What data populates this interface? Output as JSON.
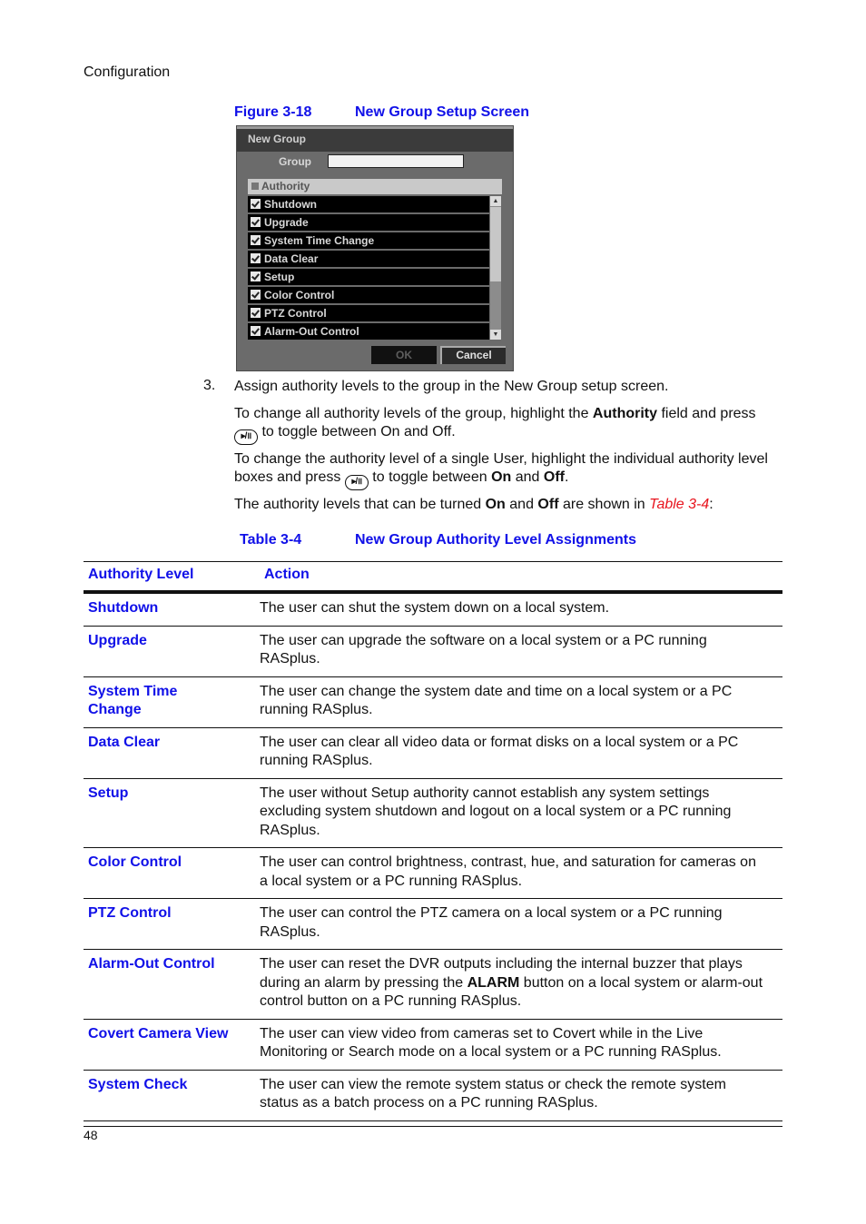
{
  "header": {
    "section": "Configuration"
  },
  "figure": {
    "number": "Figure 3-18",
    "title": "New Group Setup Screen",
    "screen": {
      "title": "New Group",
      "group_label": "Group",
      "group_value": "",
      "authority_header": "Authority",
      "items": [
        {
          "label": "Shutdown",
          "checked": true
        },
        {
          "label": "Upgrade",
          "checked": true
        },
        {
          "label": "System Time Change",
          "checked": true
        },
        {
          "label": "Data Clear",
          "checked": true
        },
        {
          "label": "Setup",
          "checked": true
        },
        {
          "label": "Color Control",
          "checked": true
        },
        {
          "label": "PTZ Control",
          "checked": true
        },
        {
          "label": "Alarm-Out Control",
          "checked": true
        }
      ],
      "scroll_up_icon": "▲",
      "scroll_down_icon": "▼",
      "ok_label": "OK",
      "cancel_label": "Cancel"
    }
  },
  "step": {
    "number": "3.",
    "text": "Assign authority levels to the group in the New Group setup screen.",
    "p2_a": "To change all authority levels of the group, highlight the ",
    "p2_bold": "Authority",
    "p2_b": " field and press ",
    "p2_c": " to toggle between On and Off.",
    "p3_a": "To change the authority level of a single User, highlight the individual authority level boxes and press ",
    "p3_b": " to toggle between ",
    "p3_on": "On",
    "p3_and": " and ",
    "p3_off": "Off",
    "p3_end": ".",
    "p4_a": "The authority levels that can be turned ",
    "p4_on": "On",
    "p4_and": " and ",
    "p4_off": "Off",
    "p4_b": " are shown in ",
    "p4_ref": "Table 3-4",
    "p4_end": ":",
    "toggle_icon_glyph": "▸/॥"
  },
  "table": {
    "number": "Table 3-4",
    "title": "New Group Authority Level Assignments",
    "headers": [
      "Authority Level",
      "Action"
    ],
    "rows": [
      {
        "level": "Shutdown",
        "action": "The user can shut the system down on a local system."
      },
      {
        "level": "Upgrade",
        "action": "The user can upgrade the software on a local system or a PC running RASplus."
      },
      {
        "level": "System Time Change",
        "action": "The user can change the system date and time on a local system or a PC running RASplus."
      },
      {
        "level": "Data Clear",
        "action": "The user can clear all video data or format disks on a local system or a PC running RASplus."
      },
      {
        "level": "Setup",
        "action": "The user without Setup authority cannot establish any system settings excluding system shutdown and logout on a local system or a PC running RASplus."
      },
      {
        "level": "Color Control",
        "action": "The user can control brightness, contrast, hue, and saturation for cameras on a local system or a PC running RASplus."
      },
      {
        "level": "PTZ Control",
        "action": "The user can control the PTZ camera on a local system or a PC running RASplus."
      },
      {
        "level": "Alarm-Out Control",
        "action_a": "The user can reset the DVR outputs including the internal buzzer that plays during an alarm by pressing the ",
        "action_bold": "ALARM",
        "action_b": " button on a local system or alarm-out control button on a PC running RASplus."
      },
      {
        "level": "Covert Camera View",
        "action": "The user can view video from cameras set to Covert while in the Live Monitoring or Search mode on a local system or a PC running RASplus."
      },
      {
        "level": "System Check",
        "action": "The user can view the remote system status or check the remote system status as a batch process on a PC running RASplus."
      }
    ]
  },
  "footer": {
    "page_number": "48"
  },
  "colors": {
    "caption_blue": "#1010e8",
    "reference_red": "#e8141e"
  }
}
